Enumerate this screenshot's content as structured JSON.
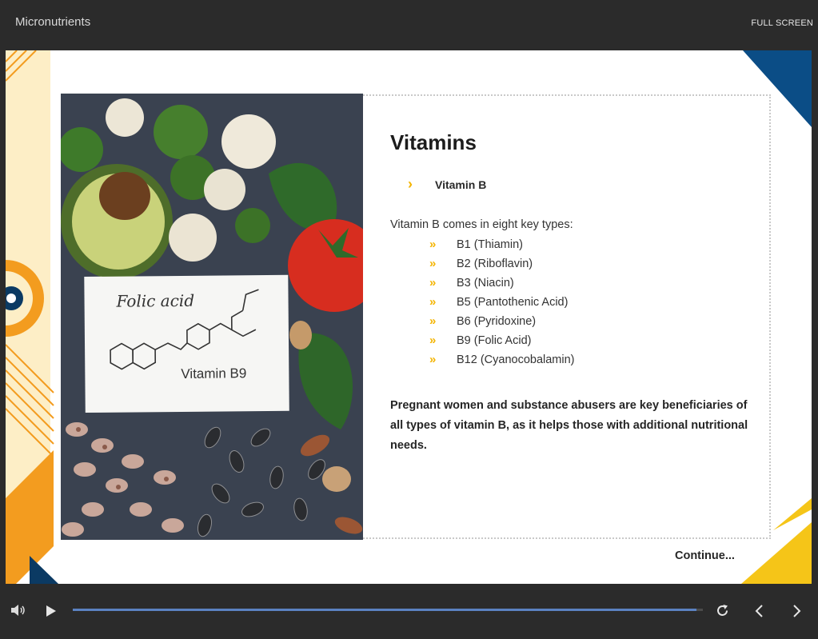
{
  "header": {
    "title": "Micronutrients",
    "fullscreen_label": "FULL SCREEN"
  },
  "slide": {
    "heading": "Vitamins",
    "subheading": "Vitamin B",
    "intro": "Vitamin B comes in eight key types:",
    "types": [
      "B1 (Thiamin)",
      "B2 (Riboflavin)",
      "B3 (Niacin)",
      "B5 (Pantothenic Acid)",
      "B6 (Pyridoxine)",
      "B9 (Folic Acid)",
      "B12 (Cyanocobalamin)"
    ],
    "summary": "Pregnant women and substance abusers are key beneficiaries of all types of vitamin B, as it helps those with additional nutritional needs.",
    "continue_label": "Continue...",
    "photo": {
      "card_title": "Folic acid",
      "card_caption": "Vitamin B9"
    }
  },
  "player": {
    "progress_fraction": 0.99
  },
  "colors": {
    "accent_yellow": "#f4b400",
    "accent_orange": "#f39c1f",
    "accent_navy": "#0b3a63",
    "progress_blue": "#5b82c2"
  },
  "icons": {
    "chevron": "chevron-right-icon",
    "double_chevron": "double-chevron-right-icon",
    "volume": "volume-icon",
    "play": "play-icon",
    "replay": "replay-icon",
    "prev": "prev-slide-icon",
    "next": "next-slide-icon"
  }
}
